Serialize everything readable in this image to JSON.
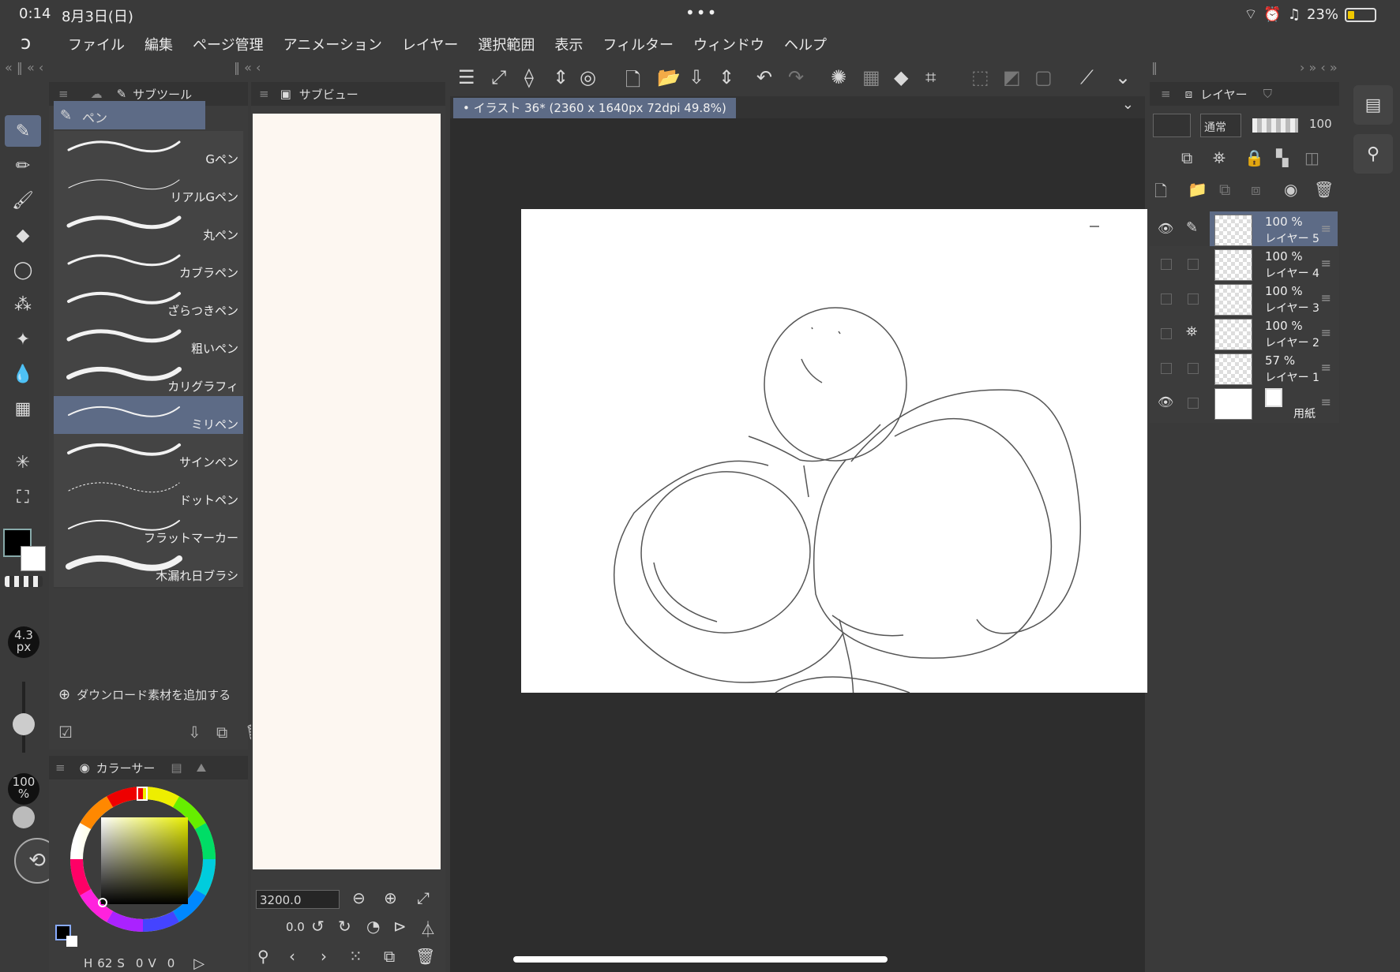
{
  "status": {
    "time": "0:14",
    "date": "8月3日(日)",
    "battery": "23%"
  },
  "menu": [
    "ファイル",
    "編集",
    "ページ管理",
    "アニメーション",
    "レイヤー",
    "選択範囲",
    "表示",
    "フィルター",
    "ウィンドウ",
    "ヘルプ"
  ],
  "subtool": {
    "tab_label": "サブツール",
    "group": "ペン",
    "brushes": [
      "Gペン",
      "リアルGペン",
      "丸ペン",
      "カブラペン",
      "ざらつきペン",
      "粗いペン",
      "カリグラフィ",
      "ミリペン",
      "サインペン",
      "ドットペン",
      "フラットマーカー",
      "木漏れ日ブラシ"
    ],
    "selected": "ミリペン",
    "add_material": "ダウンロード素材を追加する"
  },
  "brush_size": {
    "value": "4.3",
    "unit": "px"
  },
  "brush_opacity": {
    "value": "100",
    "unit": "%"
  },
  "color": {
    "tab_label": "カラーサー",
    "h_label": "H",
    "h": "62",
    "s_label": "S",
    "s": "0",
    "v_label": "V",
    "v": "0",
    "fg": "#000000",
    "bg": "#ffffff",
    "accent": "#5d6b86"
  },
  "subview": {
    "tab_label": "サブビュー",
    "zoom": "3200.0",
    "rotation": "0.0"
  },
  "canvas": {
    "tab_label": "イラスト 36* (2360 x 1640px 72dpi 49.8%)"
  },
  "layers": {
    "tab_label": "レイヤー",
    "blend_mode": "通常",
    "opacity": "100",
    "items": [
      {
        "opacity": "100 %",
        "name": "レイヤー 5",
        "selected": true
      },
      {
        "opacity": "100 %",
        "name": "レイヤー 4"
      },
      {
        "opacity": "100 %",
        "name": "レイヤー 3"
      },
      {
        "opacity": "100 %",
        "name": "レイヤー 2"
      },
      {
        "opacity": "57 %",
        "name": "レイヤー 1"
      },
      {
        "opacity": "",
        "name": "用紙"
      }
    ]
  }
}
